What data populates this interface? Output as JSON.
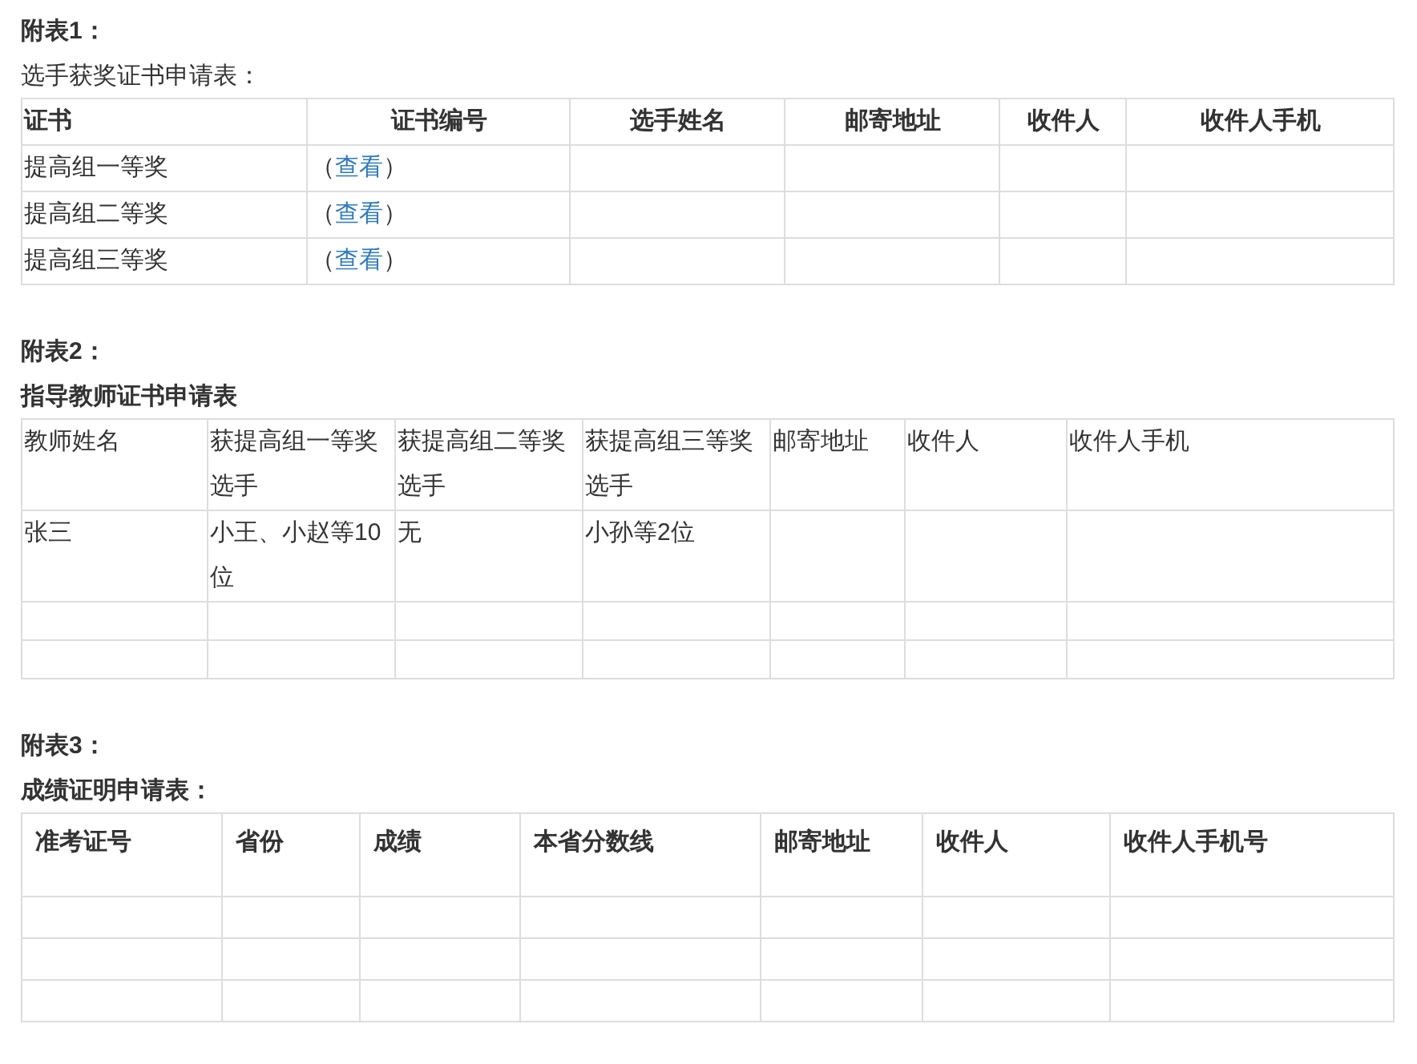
{
  "sections": [
    {
      "kind": "award",
      "title": "附表1：",
      "subtitle": "选手获奖证书申请表：",
      "table": {
        "columns": [
          "证书",
          "证书编号",
          "选手姓名",
          "邮寄地址",
          "收件人",
          "收件人手机"
        ],
        "rows": [
          {
            "certificate": "提高组一等奖",
            "number": {
              "before": "（",
              "link": "查看",
              "after": "）"
            }
          },
          {
            "certificate": "提高组二等奖",
            "number": {
              "before": "（",
              "link": "查看",
              "after": "）"
            }
          },
          {
            "certificate": "提高组三等奖",
            "number": {
              "before": "（",
              "link": "查看",
              "after": "）"
            }
          }
        ]
      }
    },
    {
      "kind": "teacher",
      "title": "附表2：",
      "subtitle": "指导教师证书申请表",
      "table": {
        "columns": [
          "教师姓名",
          "获提高组一等奖选手",
          "获提高组二等奖选手",
          "获提高组三等奖选手",
          "邮寄地址",
          "收件人",
          "收件人手机"
        ],
        "rows": [
          {
            "cells": [
              "张三",
              "小王、小赵等10位",
              "无",
              "小孙等2位"
            ]
          }
        ]
      }
    },
    {
      "kind": "score",
      "title": "附表3：",
      "subtitle": "成绩证明申请表：",
      "table": {
        "columns": [
          "准考证号",
          "省份",
          "成绩",
          "本省分数线",
          "邮寄地址",
          "收件人",
          "收件人手机号"
        ]
      }
    }
  ]
}
